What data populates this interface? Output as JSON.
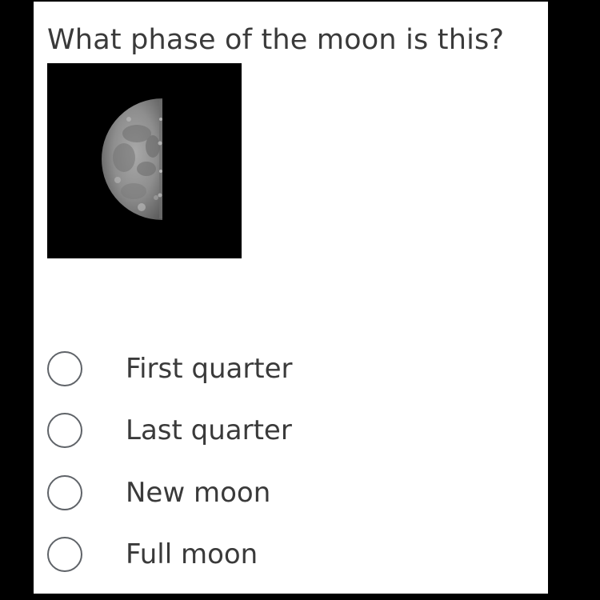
{
  "question": {
    "text": "What phase of the moon is this?"
  },
  "image": {
    "subject": "half-moon-photo",
    "background_color": "#000000"
  },
  "options": [
    {
      "label": "First quarter",
      "selected": false
    },
    {
      "label": "Last quarter",
      "selected": false
    },
    {
      "label": "New moon",
      "selected": false
    },
    {
      "label": "Full moon",
      "selected": false
    }
  ],
  "colors": {
    "page_frame": "#000000",
    "card_background": "#ffffff",
    "text": "#3a3a3a",
    "radio_border": "#5f6368"
  }
}
